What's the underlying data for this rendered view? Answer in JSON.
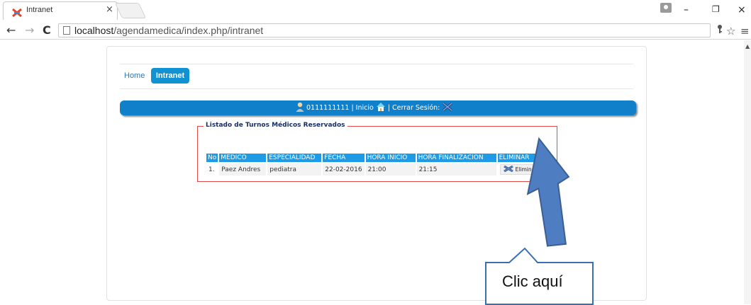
{
  "browser": {
    "tab_title": "Intranet",
    "tab_close": "×",
    "url_host": "localhost",
    "url_path": "/agendamedica/index.php/intranet",
    "win_minimize": "–",
    "win_restore": "❐",
    "win_close": "×",
    "nav_back": "←",
    "nav_forward": "→",
    "nav_reload": "C"
  },
  "nav": {
    "home_label": "Home",
    "intranet_label": "Intranet"
  },
  "userbar": {
    "user_id": "0111111111",
    "separator": "|",
    "inicio_label": "Inicio",
    "cerrar_label": "Cerrar Sesión:"
  },
  "listado": {
    "legend": "Listado de Turnos Médicos Reservados",
    "headers": [
      "No",
      "MEDICO",
      "ESPECIALIDAD",
      "FECHA",
      "HORA INICIO",
      "HORA FINALIZACION",
      "ELIMINAR"
    ],
    "rows": [
      {
        "no": "1.",
        "medico": "Paez Andres",
        "especialidad": "pediatra",
        "fecha": "22-02-2016",
        "hora_inicio": "21:00",
        "hora_fin": "21:15",
        "eliminar": "Eliminar"
      }
    ]
  },
  "annotation": {
    "callout_text": "Clic aquí"
  },
  "colors": {
    "accent": "#1192d3",
    "userbar": "#0f80c9",
    "fieldset_border": "#e04a4a",
    "arrow_fill": "#4e7ec1"
  }
}
